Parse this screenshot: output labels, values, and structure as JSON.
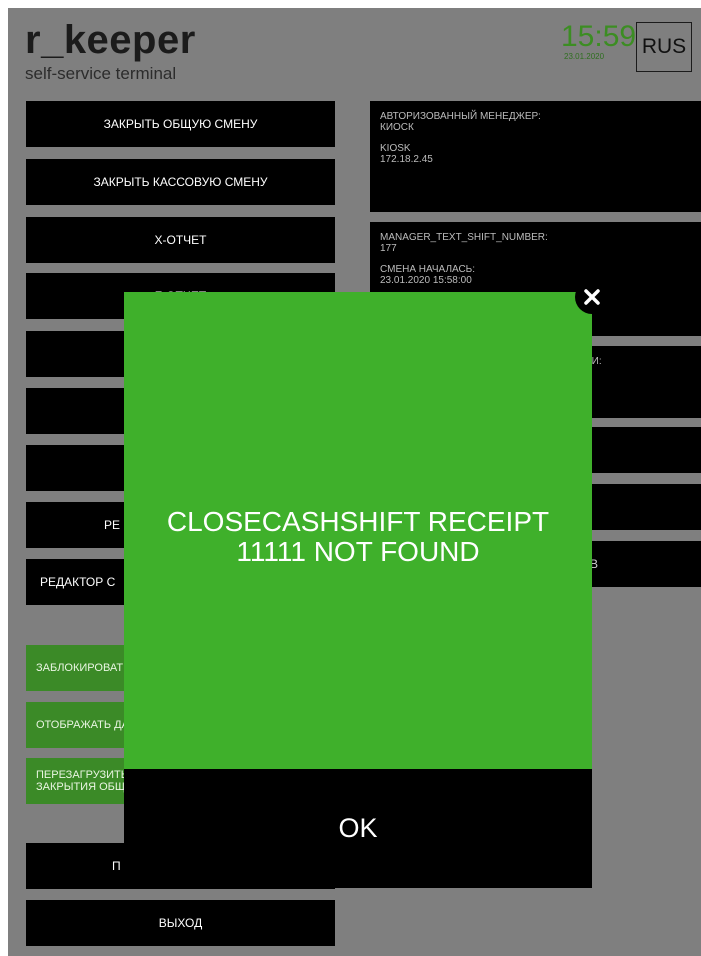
{
  "header": {
    "logo_main": "r_keeper",
    "logo_sub": "self-service terminal",
    "time": "15:59",
    "date": "23.01.2020",
    "language": "RUS"
  },
  "menu": {
    "close_general_shift": "ЗАКРЫТЬ ОБЩУЮ СМЕНУ",
    "close_cash_shift": "ЗАКРЫТЬ КАССОВУЮ СМЕНУ",
    "x_report": "X-ОТЧЕТ",
    "z_report": "Z-ОТЧЕТ",
    "partial_re": "РЕ",
    "editor_partial": "РЕДАКТОР С",
    "block_partial": "ЗАБЛОКИРОВАТ",
    "display_partial": "ОТОБРАЖАТЬ ДА",
    "reload_partial_1": "ПЕРЕЗАГРУЗИТЬ",
    "reload_partial_2": "ЗАКРЫТИЯ ОБЩ",
    "partial_p": "П",
    "exit": "ВЫХОД"
  },
  "info": {
    "manager_label": "АВТОРИЗОВАННЫЙ МЕНЕДЖЕР:",
    "manager_value": "КИОСК",
    "kiosk_label": "KIOSK",
    "kiosk_ip": "172.18.2.45",
    "shift_number_label": "MANAGER_TEXT_SHIFT_NUMBER:",
    "shift_number": "177",
    "shift_started_label": "СМЕНА НАЧАЛАСЬ:",
    "shift_started_value": "23.01.2020 15:58:00",
    "partial_label": "ВИ:",
    "partial_b": "В"
  },
  "modal": {
    "message_line1": "CLOSECASHSHIFT RECEIPT",
    "message_line2": "11111 NOT FOUND",
    "ok_label": "OK",
    "close_icon": "close-icon"
  }
}
